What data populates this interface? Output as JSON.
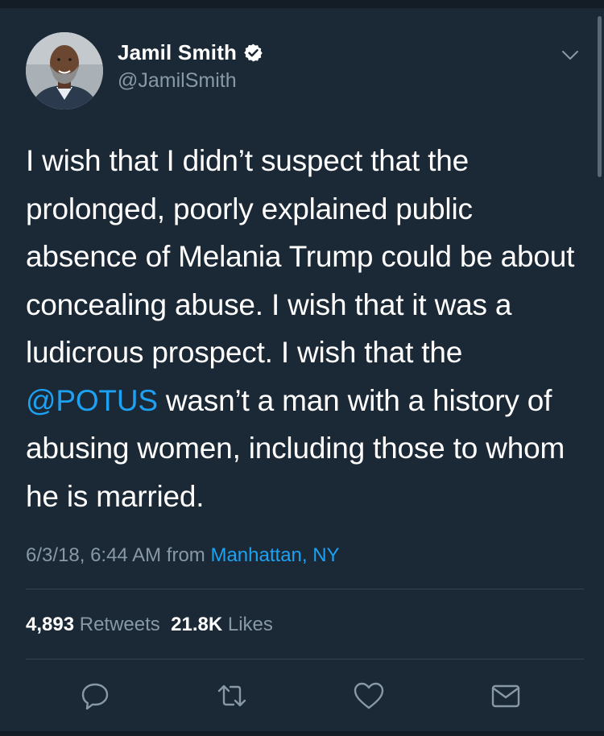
{
  "author": {
    "name": "Jamil Smith",
    "handle": "@JamilSmith",
    "verified": true,
    "avatar_icon": "profile-photo"
  },
  "tweet": {
    "text_before_mention": "I wish that I didn’t suspect that the prolonged, poorly explained public absence of Melania Trump could be about concealing abuse. I wish that it was a ludicrous prospect. I wish that the ",
    "mention": "@POTUS",
    "text_after_mention": " wasn’t a man with a history of abusing women, including those to whom he is married."
  },
  "meta": {
    "timestamp": "6/3/18, 6:44 AM",
    "from_label": "from",
    "location": "Manhattan, NY"
  },
  "stats": {
    "retweets_count": "4,893",
    "retweets_label": "Retweets",
    "likes_count": "21.8K",
    "likes_label": "Likes"
  },
  "actions": {
    "reply_icon": "reply-icon",
    "retweet_icon": "retweet-icon",
    "like_icon": "heart-icon",
    "share_icon": "envelope-icon"
  },
  "colors": {
    "background": "#1b2836",
    "accent": "#1da1f2",
    "secondary_text": "#8899a6",
    "divider": "#38444d"
  }
}
